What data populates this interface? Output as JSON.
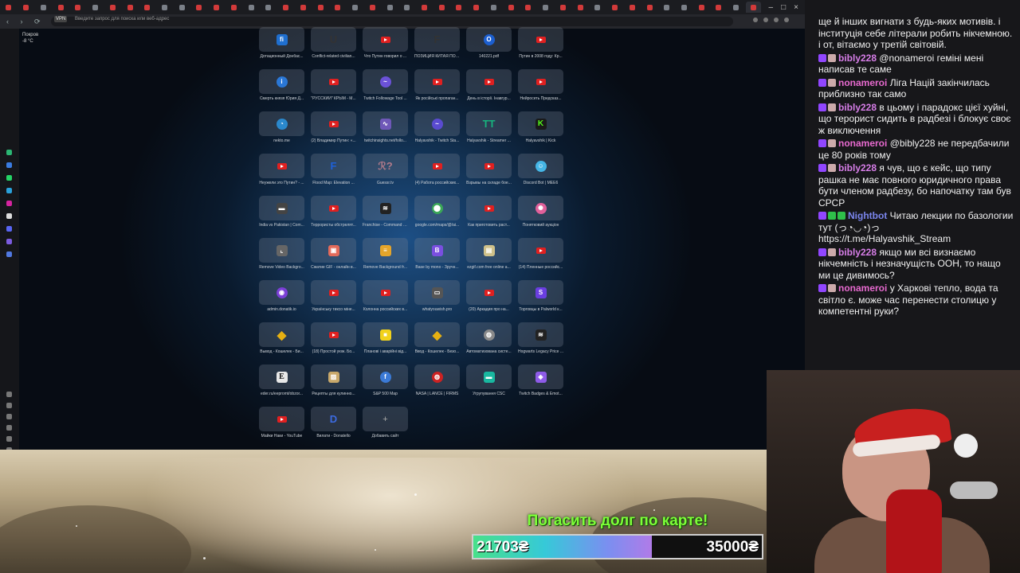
{
  "browser": {
    "address_placeholder": "Введите запрос для поиска или веб-адрес",
    "vpn_label": "VPN",
    "nav_symbols": "‹ › ⟳",
    "window_controls": [
      "–",
      "□",
      "×"
    ],
    "weather": {
      "city": "Покров",
      "temp": "-8 °C"
    }
  },
  "speed_dial": [
    {
      "label": "Дотационный Донбас...",
      "icon": "fi",
      "color": "#1f6fcf",
      "kind": "square"
    },
    {
      "label": "Conflict-related civilian...",
      "icon": "U",
      "color": "#333",
      "kind": "txt"
    },
    {
      "label": "Что Путин говорил о ...",
      "icon": "youtube",
      "color": "#e02020",
      "kind": "yt"
    },
    {
      "label": "ПОЗИЦИЯ КИТАЯ ПО ...",
      "icon": "F",
      "color": "#333",
      "kind": "txt"
    },
    {
      "label": "140221.pdf",
      "icon": "O",
      "color": "#1c5fd0",
      "kind": "round"
    },
    {
      "label": "Путин в 2008 году: Кр...",
      "icon": "youtube",
      "color": "#e02020",
      "kind": "yt"
    },
    {
      "label": "Смерть князя Юрия Д...",
      "icon": "i",
      "color": "#2a77d6",
      "kind": "round"
    },
    {
      "label": "\"РУССКИЙ\" КРЫМ - М...",
      "icon": "youtube",
      "color": "#e02020",
      "kind": "yt"
    },
    {
      "label": "Twitch Followage Tool ...",
      "icon": "~",
      "color": "#6b52d8",
      "kind": "round"
    },
    {
      "label": "Як російські пропаган...",
      "icon": "youtube",
      "color": "#e02020",
      "kind": "yt"
    },
    {
      "label": "День в історії. Інавгур...",
      "icon": "youtube",
      "color": "#e02020",
      "kind": "yt"
    },
    {
      "label": "Нейросеть Предсказ...",
      "icon": "youtube",
      "color": "#e02020",
      "kind": "yt"
    },
    {
      "label": "nekto.me",
      "icon": "◔",
      "color": "#2a88cc",
      "kind": "round"
    },
    {
      "label": "(2) Владимир Путин: «...",
      "icon": "youtube",
      "color": "#e02020",
      "kind": "yt"
    },
    {
      "label": "twitchinsights.net/follo...",
      "icon": "∿",
      "color": "#6f58b8",
      "kind": "square"
    },
    {
      "label": "Halyavshik - Twitch Sta...",
      "icon": "~",
      "color": "#5a4bd0",
      "kind": "round"
    },
    {
      "label": "Halyavshik - Streamer ...",
      "icon": "TT",
      "color": "#17b37e",
      "kind": "txt"
    },
    {
      "label": "Halyavshik | Kick",
      "icon": "K",
      "color": "#1a1a1a",
      "kind": "kick"
    },
    {
      "label": "Неужели это Путин? - ...",
      "icon": "youtube",
      "color": "#e02020",
      "kind": "yt"
    },
    {
      "label": "Flood Map: Elevation ...",
      "icon": "F",
      "color": "#1e60d8",
      "kind": "txt"
    },
    {
      "label": "Guessr.tv",
      "icon": "ℛ?",
      "color": "#b07a8a",
      "kind": "txt"
    },
    {
      "label": "(4) Работа российских...",
      "icon": "youtube",
      "color": "#e02020",
      "kind": "yt"
    },
    {
      "label": "Взрывы на складе бое...",
      "icon": "youtube",
      "color": "#e02020",
      "kind": "yt"
    },
    {
      "label": "Discord Bot | MEE6",
      "icon": "☺",
      "color": "#45b6e6",
      "kind": "round"
    },
    {
      "label": "India vs Pakistan | Com...",
      "icon": "▬",
      "color": "#444",
      "kind": "square"
    },
    {
      "label": "Террористы обстрелят...",
      "icon": "youtube",
      "color": "#e02020",
      "kind": "yt"
    },
    {
      "label": "Franchise - Command a...",
      "icon": "≋",
      "color": "#222",
      "kind": "square"
    },
    {
      "label": "google.com/maps/@/ai...",
      "icon": "⬤",
      "color": "#3aa757",
      "kind": "round"
    },
    {
      "label": "Как приготовить раст...",
      "icon": "youtube",
      "color": "#e02020",
      "kind": "yt"
    },
    {
      "label": "Понятковий аукціон",
      "icon": "✺",
      "color": "#e0609a",
      "kind": "round"
    },
    {
      "label": "Remove Video Backgro...",
      "icon": "⌞",
      "color": "#666",
      "kind": "square"
    },
    {
      "label": "Сжатие GIF - онлайн в...",
      "icon": "▣",
      "color": "#e36a5a",
      "kind": "square"
    },
    {
      "label": "Remove Background fr...",
      "icon": "≡",
      "color": "#e5a52a",
      "kind": "square"
    },
    {
      "label": "Base by mono - Зручн...",
      "icon": "B",
      "color": "#7a4fe0",
      "kind": "square"
    },
    {
      "label": "ezgif.com free online a...",
      "icon": "▤",
      "color": "#cfc18a",
      "kind": "square"
    },
    {
      "label": "(14) Пленные российс...",
      "icon": "youtube",
      "color": "#e02020",
      "kind": "yt"
    },
    {
      "label": "admin.donatik.io",
      "icon": "◉",
      "color": "#7b3fd6",
      "kind": "round"
    },
    {
      "label": "Українську тиксо міне...",
      "icon": "youtube",
      "color": "#e02020",
      "kind": "yt"
    },
    {
      "label": "Колонна российских в...",
      "icon": "youtube",
      "color": "#e02020",
      "kind": "yt"
    },
    {
      "label": "whatyouwish.pro",
      "icon": "▭",
      "color": "#555",
      "kind": "square"
    },
    {
      "label": "(20) Аркадия про на...",
      "icon": "youtube",
      "color": "#e02020",
      "kind": "yt"
    },
    {
      "label": "Торговцы в Palworld к...",
      "icon": "S",
      "color": "#6a3ee0",
      "kind": "square"
    },
    {
      "label": "Вывод - Кошелек - Би...",
      "icon": "◆",
      "color": "#e6b012",
      "kind": "diamond"
    },
    {
      "label": "(18) Простой уюж. Бо...",
      "icon": "youtube",
      "color": "#e02020",
      "kind": "yt"
    },
    {
      "label": "Планові і аварійні від...",
      "icon": "■",
      "color": "#f2d21b",
      "kind": "square"
    },
    {
      "label": "Ввод - Кошелек - Безо...",
      "icon": "◆",
      "color": "#e6b012",
      "kind": "diamond"
    },
    {
      "label": "Автоматизована систе...",
      "icon": "◍",
      "color": "#8a8a8a",
      "kind": "round"
    },
    {
      "label": "Hogwarts Legacy Price ...",
      "icon": "≋",
      "color": "#222",
      "kind": "square"
    },
    {
      "label": "eder.ru/eepromt/obzor...",
      "icon": "E",
      "color": "#e8e8e8",
      "kind": "edge"
    },
    {
      "label": "Рецепты для кулинно...",
      "icon": "▨",
      "color": "#c8a86a",
      "kind": "square"
    },
    {
      "label": "S&P 500 Map",
      "icon": "f",
      "color": "#3b7ad6",
      "kind": "round"
    },
    {
      "label": "NASA | LANCE | FIRMS",
      "icon": "◍",
      "color": "#c22",
      "kind": "round"
    },
    {
      "label": "Угрупування CSC",
      "icon": "▬",
      "color": "#19b8a0",
      "kind": "square"
    },
    {
      "label": "Twitch Badges & Emot...",
      "icon": "◈",
      "color": "#8e5be8",
      "kind": "square"
    },
    {
      "label": "Майки Наки - YouTube",
      "icon": "youtube",
      "color": "#e02020",
      "kind": "yt"
    },
    {
      "label": "Вилати - Donatello",
      "icon": "D",
      "color": "#3c6be0",
      "kind": "txt"
    },
    {
      "label": "Добавить сайт",
      "icon": "+",
      "color": "#aaa",
      "kind": "add"
    }
  ],
  "chat": {
    "messages": [
      {
        "user": "",
        "color": "",
        "text": "ще й інших вигнати з будь-яких мотивів. і інституція себе літерали робить нікчемною. і от, вітаємо у третій світовій."
      },
      {
        "user": "bibly228",
        "color": "#d77ee8",
        "text": "@nonameroi геміні мені написав те саме"
      },
      {
        "user": "nonameroi",
        "color": "#e86ad0",
        "text": "Ліга Націй закінчилась приблизно так само"
      },
      {
        "user": "bibly228",
        "color": "#d77ee8",
        "text": "в цьому і парадокс цієї хуйні, що терорист сидить в радбезі і блокує своє ж виключення"
      },
      {
        "user": "nonameroi",
        "color": "#e86ad0",
        "text": "@bibly228 не передбачили це 80 років тому"
      },
      {
        "user": "bibly228",
        "color": "#d77ee8",
        "text": "я чув, що є кейс, що типу рашка не має повного юридичного права бути членом радбезу, бо напочатку там був СРСР"
      },
      {
        "user": "Nightbot",
        "color": "#7b86ee",
        "text": "Читаю лекции по базологии тут (っ◔◡◔)っ https://t.me/Halyavshik_Stream"
      },
      {
        "user": "bibly228",
        "color": "#d77ee8",
        "text": "якщо ми всі визнаємо нікчемність і незначущість ООН, то нащо ми це дивимось?"
      },
      {
        "user": "nonameroi",
        "color": "#e86ad0",
        "text": "у Харкові тепло, вода та світло є. може час перенести столицю у компетентні руки?"
      }
    ]
  },
  "donation": {
    "title": "Погасить долг по карте!",
    "current": "21703₴",
    "goal": "35000₴",
    "progress": 0.62
  }
}
